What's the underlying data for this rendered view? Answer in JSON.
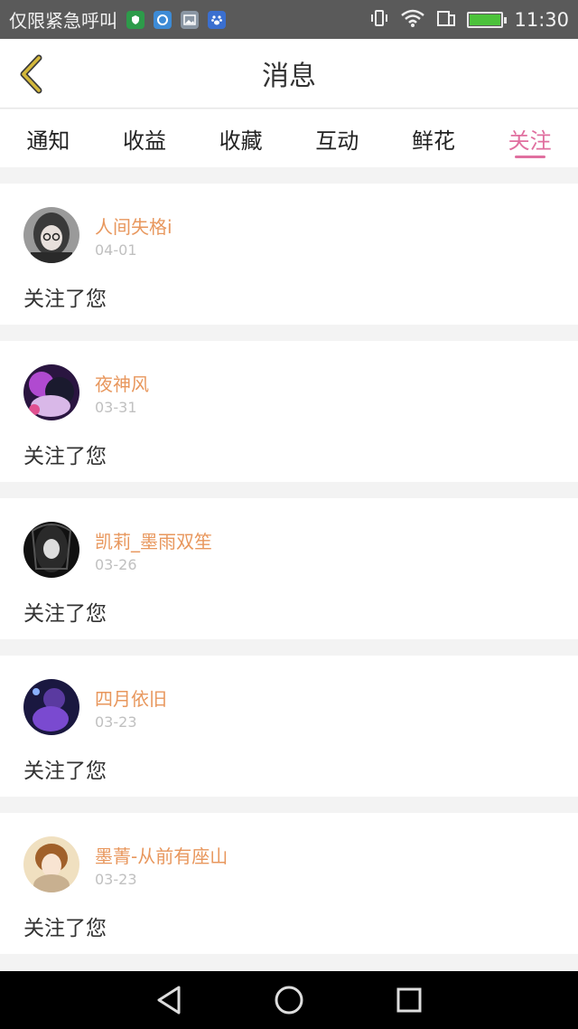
{
  "status_bar": {
    "carrier": "仅限紧急呼叫",
    "time": "11:30",
    "app_icons": [
      "shield-app-icon",
      "browser-app-icon",
      "gallery-app-icon",
      "baidu-app-icon"
    ]
  },
  "header": {
    "title": "消息"
  },
  "tabs": [
    {
      "label": "通知"
    },
    {
      "label": "收益"
    },
    {
      "label": "收藏"
    },
    {
      "label": "互动"
    },
    {
      "label": "鲜花"
    },
    {
      "label": "关注",
      "active": true
    }
  ],
  "messages": [
    {
      "name": "人间失格i",
      "date": "04-01",
      "text": "关注了您"
    },
    {
      "name": "夜神风",
      "date": "03-31",
      "text": "关注了您"
    },
    {
      "name": "凯莉_墨雨双笙",
      "date": "03-26",
      "text": "关注了您"
    },
    {
      "name": "四月依旧",
      "date": "03-23",
      "text": "关注了您"
    },
    {
      "name": "墨菁-从前有座山",
      "date": "03-23",
      "text": "关注了您"
    }
  ],
  "colors": {
    "accent": "#e06f9f",
    "name": "#e8975d",
    "date": "#c0c0c0",
    "back_icon": "#d4b83a"
  }
}
